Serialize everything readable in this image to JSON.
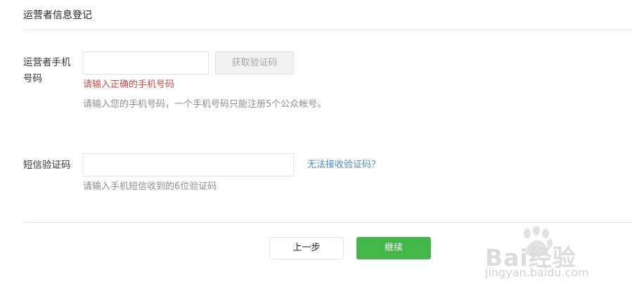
{
  "section": {
    "title": "运营者信息登记"
  },
  "phone": {
    "label": "运营者手机号码",
    "input_value": "",
    "input_placeholder": "",
    "get_code_button": "获取验证码",
    "error_text": "请输入正确的手机号码",
    "tip_text": "请输入您的手机号码，一个手机号码只能注册5个公众帐号。"
  },
  "sms": {
    "label": "短信验证码",
    "input_value": "",
    "input_placeholder": "",
    "cant_receive_link": "无法接收验证码？",
    "tip_text": "请输入手机短信收到的6位验证码"
  },
  "actions": {
    "prev_label": "上一步",
    "continue_label": "继续"
  },
  "watermark": {
    "brand": "Bai经验",
    "url": "jingyan.baidu.com"
  },
  "colors": {
    "accent_green": "#44b549",
    "error_red": "#c34b4b",
    "link_blue": "#4e8bc3"
  }
}
